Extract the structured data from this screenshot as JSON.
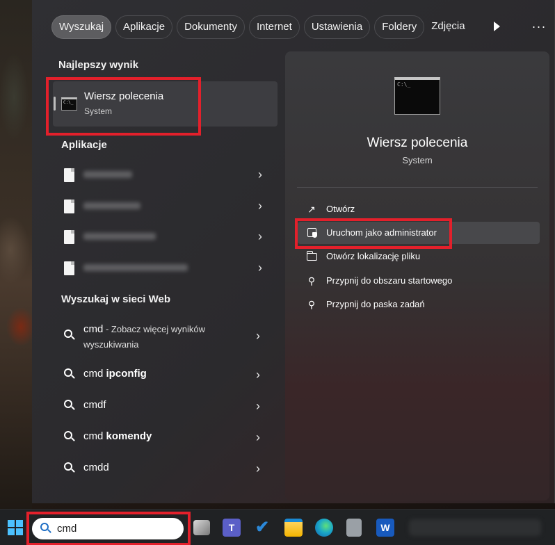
{
  "tabs": [
    "Wyszukaj",
    "Aplikacje",
    "Dokumenty",
    "Internet",
    "Ustawienia",
    "Foldery",
    "Zdjęcia"
  ],
  "icons": {
    "play": "play-icon",
    "more": "more-icon",
    "more_glyph": "···",
    "chevron": "›",
    "open_glyph": "↗",
    "pin_glyph": "⚲"
  },
  "sections": {
    "best": "Najlepszy wynik",
    "apps": "Aplikacje",
    "web": "Wyszukaj w sieci Web"
  },
  "best_result": {
    "title": "Wiersz polecenia",
    "subtitle": "System",
    "icon_text": "C:\\_"
  },
  "web_results": [
    {
      "query": "cmd",
      "suffix": "",
      "suggestion": " - Zobacz więcej wyników",
      "second_line": "wyszukiwania"
    },
    {
      "query": "cmd ",
      "suffix": "ipconfig",
      "suggestion": "",
      "second_line": ""
    },
    {
      "query": "cmdf",
      "suffix": "",
      "suggestion": "",
      "second_line": ""
    },
    {
      "query": "cmd ",
      "suffix": "komendy",
      "suggestion": "",
      "second_line": ""
    },
    {
      "query": "cmdd",
      "suffix": "",
      "suggestion": "",
      "second_line": ""
    }
  ],
  "detail": {
    "title": "Wiersz polecenia",
    "subtitle": "System",
    "actions": [
      {
        "label": "Otwórz",
        "icon": "open-icon"
      },
      {
        "label": "Uruchom jako administrator",
        "icon": "shield-icon"
      },
      {
        "label": "Otwórz lokalizację pliku",
        "icon": "folder-icon"
      },
      {
        "label": "Przypnij do obszaru startowego",
        "icon": "pin-icon"
      },
      {
        "label": "Przypnij do paska zadań",
        "icon": "pin-icon"
      }
    ]
  },
  "taskbar": {
    "search_value": "cmd",
    "word_label": "W",
    "teams_label": "T"
  },
  "colors": {
    "highlight_red": "#e3202b",
    "windows_blue": "#4cc2ff",
    "edge_teal": "#1ba8c7",
    "teams_purple": "#5b5fc7"
  }
}
